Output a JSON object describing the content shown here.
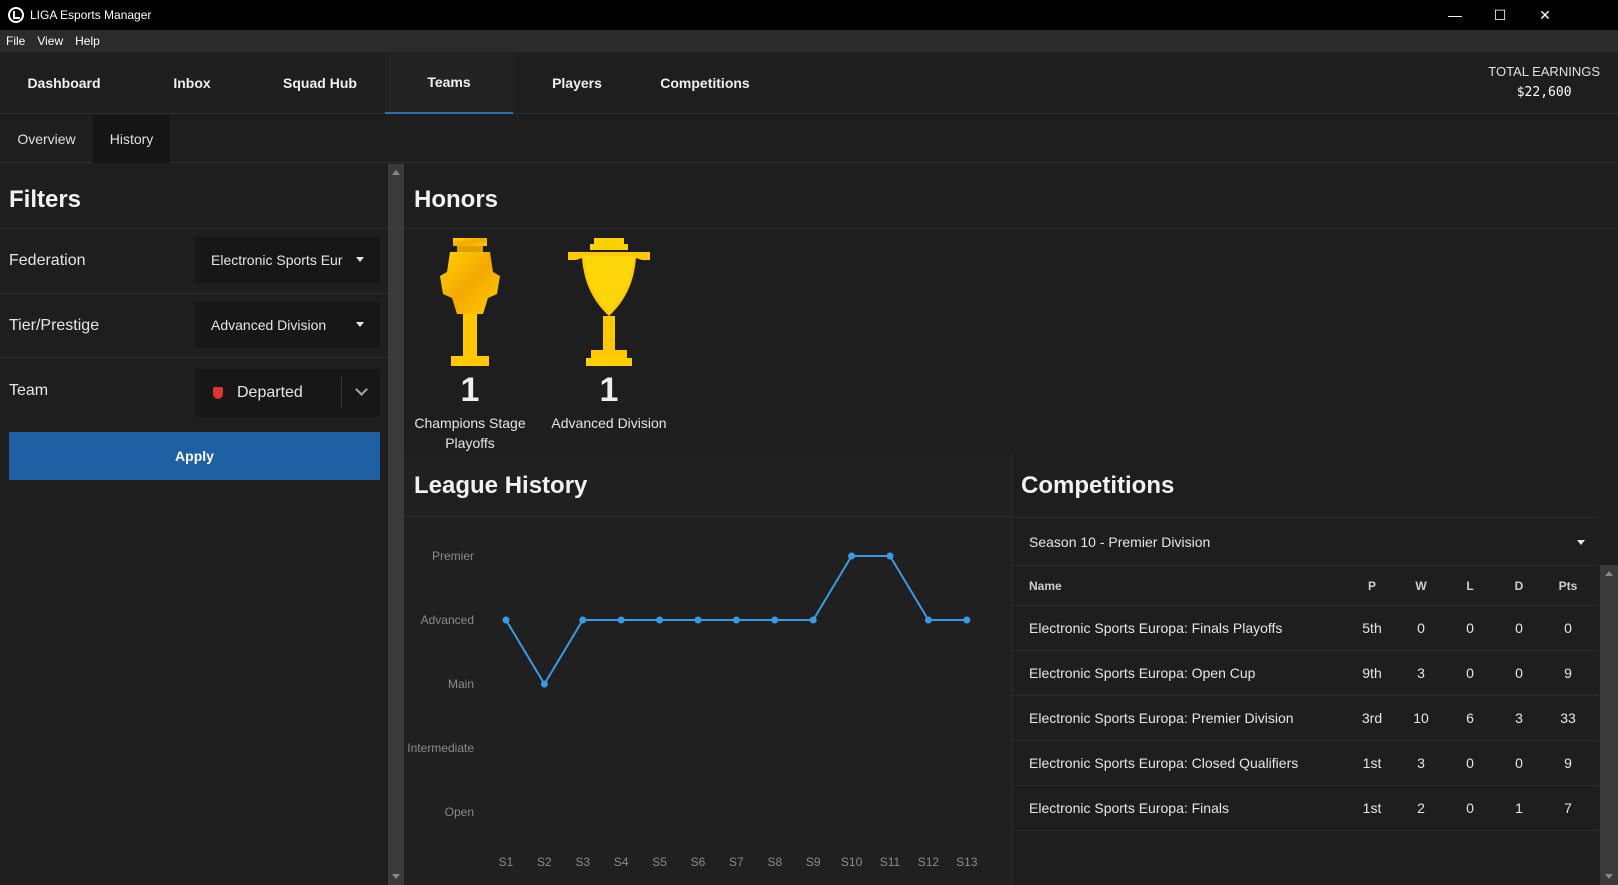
{
  "window": {
    "title": "LIGA Esports Manager"
  },
  "menu": [
    "File",
    "View",
    "Help"
  ],
  "nav": {
    "tabs": [
      "Dashboard",
      "Inbox",
      "Squad Hub",
      "Teams",
      "Players",
      "Competitions"
    ],
    "active": "Teams",
    "earnings_label": "TOTAL EARNINGS",
    "earnings_value": "$22,600"
  },
  "subnav": {
    "tabs": [
      "Overview",
      "History"
    ],
    "active": "History"
  },
  "filters": {
    "title": "Filters",
    "federation_label": "Federation",
    "federation_value": "Electronic Sports Eur",
    "tier_label": "Tier/Prestige",
    "tier_value": "Advanced Division",
    "team_label": "Team",
    "team_value": "Departed",
    "apply": "Apply"
  },
  "honors": {
    "title": "Honors",
    "items": [
      {
        "count": "1",
        "name": "Champions Stage Playoffs",
        "icon": "trophy-tall-icon"
      },
      {
        "count": "1",
        "name": "Advanced Division",
        "icon": "trophy-cup-icon"
      }
    ]
  },
  "league_history": {
    "title": "League History"
  },
  "chart_data": {
    "type": "line",
    "title": "",
    "categories": [
      "S1",
      "S2",
      "S3",
      "S4",
      "S5",
      "S6",
      "S7",
      "S8",
      "S9",
      "S10",
      "S11",
      "S12",
      "S13"
    ],
    "y_levels": [
      "Open",
      "Intermediate",
      "Main",
      "Advanced",
      "Premier"
    ],
    "values": [
      "Advanced",
      "Main",
      "Advanced",
      "Advanced",
      "Advanced",
      "Advanced",
      "Advanced",
      "Advanced",
      "Advanced",
      "Premier",
      "Premier",
      "Advanced",
      "Advanced"
    ],
    "line_color": "#3b9ae1",
    "grid": false
  },
  "competitions": {
    "title": "Competitions",
    "season": "Season 10 - Premier Division",
    "columns": [
      "Name",
      "P",
      "W",
      "L",
      "D",
      "Pts"
    ],
    "rows": [
      [
        "Electronic Sports Europa: Finals Playoffs",
        "5th",
        "0",
        "0",
        "0",
        "0"
      ],
      [
        "Electronic Sports Europa: Open Cup",
        "9th",
        "3",
        "0",
        "0",
        "9"
      ],
      [
        "Electronic Sports Europa: Premier Division",
        "3rd",
        "10",
        "6",
        "3",
        "33"
      ],
      [
        "Electronic Sports Europa: Closed Qualifiers",
        "1st",
        "3",
        "0",
        "0",
        "9"
      ],
      [
        "Electronic Sports Europa: Finals",
        "1st",
        "2",
        "0",
        "1",
        "7"
      ]
    ]
  }
}
